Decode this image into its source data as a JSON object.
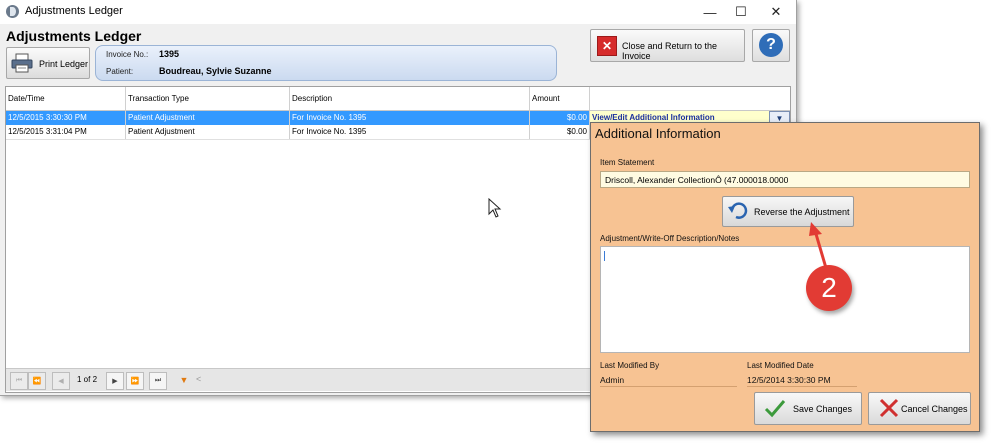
{
  "window": {
    "title": "Adjustments Ledger",
    "controls": {
      "minimize": "—",
      "maximize": "☐",
      "close": "✕"
    }
  },
  "ledger": {
    "heading": "Adjustments Ledger",
    "print_label": "Print Ledger",
    "invoice_label": "Invoice No.:",
    "invoice_value": "1395",
    "patient_label": "Patient:",
    "patient_value": "Boudreau, Sylvie Suzanne",
    "close_label": "Close and Return to the Invoice",
    "help_glyph": "?"
  },
  "grid": {
    "columns": [
      "Date/Time",
      "Transaction Type",
      "Description",
      "Amount"
    ],
    "rows": [
      {
        "date": "12/5/2015 3:30:30 PM",
        "type": "Patient Adjustment",
        "desc": "For Invoice No. 1395",
        "amount": "$0.00",
        "selected": true
      },
      {
        "date": "12/5/2015 3:31:04 PM",
        "type": "Patient Adjustment",
        "desc": "For Invoice No. 1395",
        "amount": "$0.00",
        "selected": false
      }
    ],
    "link_label": "View/Edit Additional Information",
    "pager": {
      "page_text": "1 of 2"
    }
  },
  "popup": {
    "title": "Additional Information",
    "item_statement_label": "Item Statement",
    "item_statement_value": "Driscoll, Alexander CollectionÔ (47.000018.0000",
    "reverse_label": "Reverse the Adjustment",
    "notes_label": "Adjustment/Write-Off Description/Notes",
    "modified_by_label": "Last Modified By",
    "modified_by_value": "Admin",
    "modified_date_label": "Last Modified Date",
    "modified_date_value": "12/5/2014 3:30:30 PM",
    "save_label": "Save Changes",
    "cancel_label": "Cancel Changes"
  },
  "annotation": {
    "number": "2"
  },
  "colors": {
    "selected_row": "#3399ff",
    "popup_bg": "#f7c393",
    "link_text": "#1a2f9e",
    "callout": "#e23b34"
  }
}
